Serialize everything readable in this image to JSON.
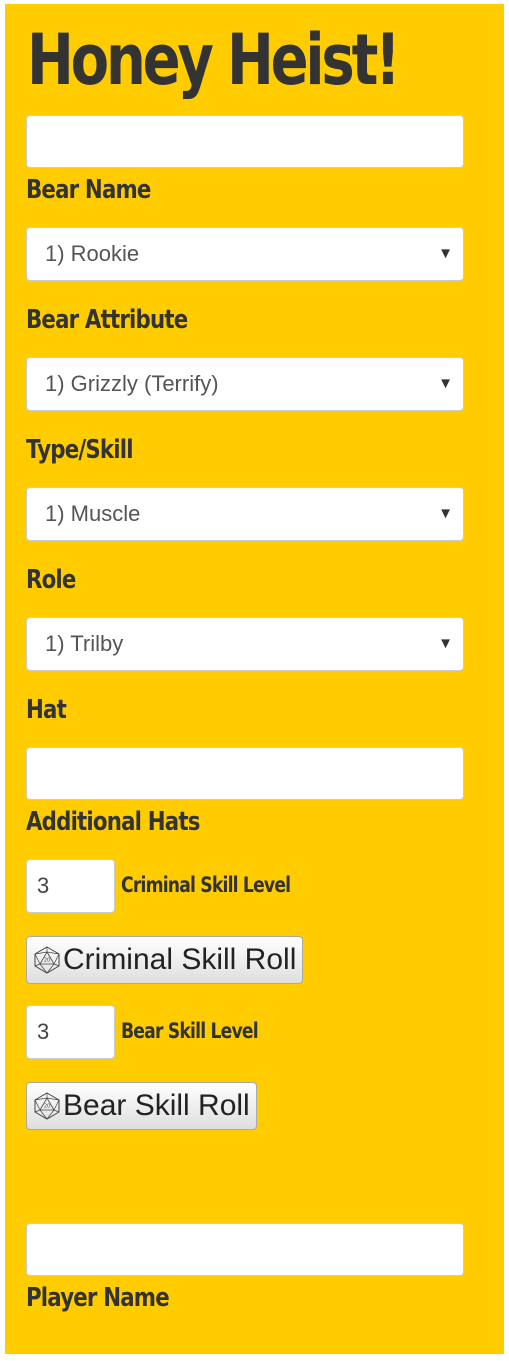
{
  "app": {
    "title": "Honey Heist!"
  },
  "colors": {
    "background": "#FFCC00",
    "text": "#333333"
  },
  "fields": {
    "bear_name": {
      "value": "",
      "label": "Bear Name"
    },
    "bear_attribute": {
      "selected": "1) Rookie",
      "label": "Bear Attribute"
    },
    "type_skill": {
      "selected": "1) Grizzly (Terrify)",
      "label": "Type/Skill"
    },
    "role": {
      "selected": "1) Muscle",
      "label": "Role"
    },
    "hat": {
      "selected": "1) Trilby",
      "label": "Hat"
    },
    "additional_hats": {
      "value": "",
      "label": "Additional Hats"
    },
    "criminal_skill": {
      "value": "3",
      "label": "Criminal Skill Level",
      "button_label": "Criminal Skill Roll",
      "button_icon": "d20-die-icon"
    },
    "bear_skill": {
      "value": "3",
      "label": "Bear Skill Level",
      "button_label": "Bear Skill Roll",
      "button_icon": "d20-die-icon"
    },
    "player_name": {
      "value": "",
      "label": "Player Name"
    }
  },
  "icons": {
    "select_arrow": "dropdown-arrow-icon",
    "select_arrow_glyph": "▼",
    "die_face_number": "20"
  }
}
